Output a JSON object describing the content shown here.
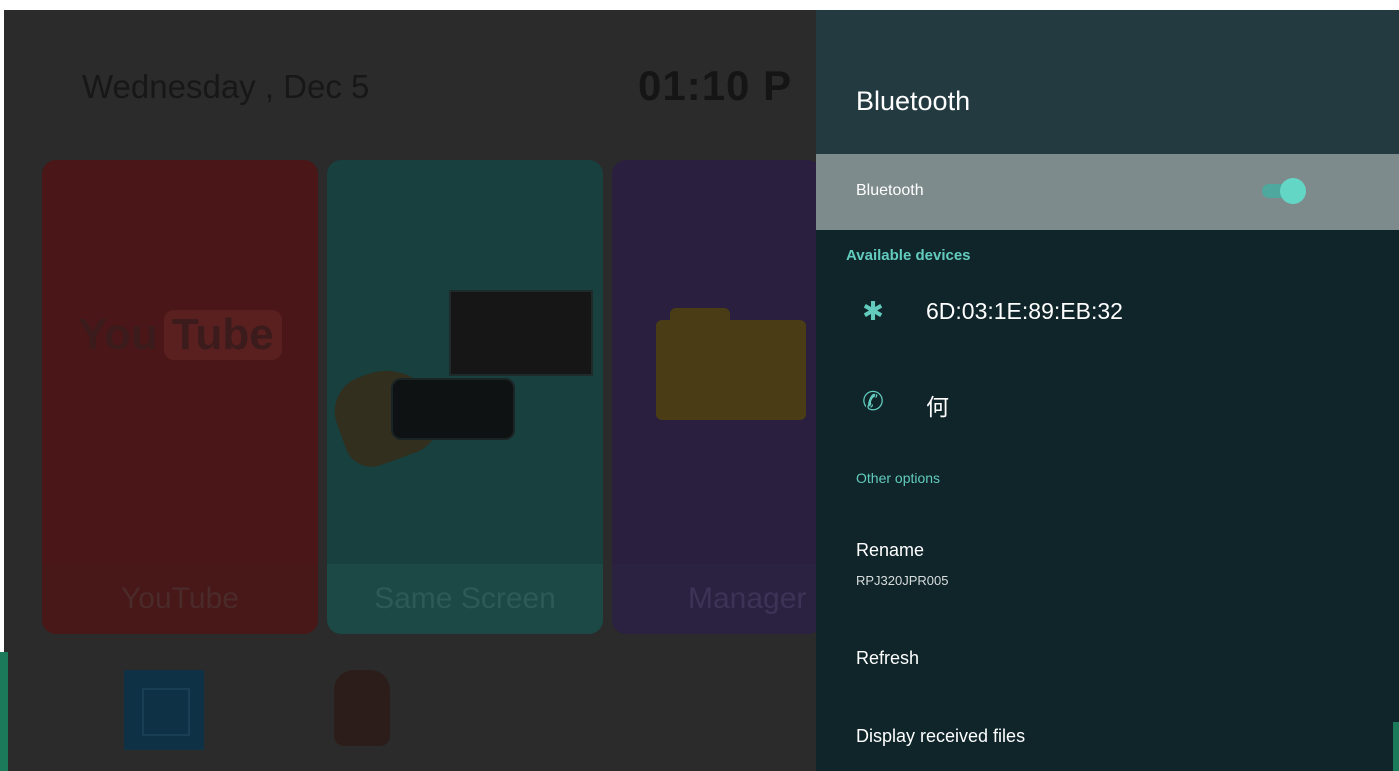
{
  "launcher": {
    "date": "Wednesday , Dec 5",
    "time": "01:10",
    "time_suffix": "P",
    "tiles": [
      {
        "label": "YouTube",
        "logo_you": "You",
        "logo_tube": "Tube"
      },
      {
        "label": "Same Screen"
      },
      {
        "label": "Manager"
      }
    ]
  },
  "panel": {
    "title": "Bluetooth",
    "toggle": {
      "label": "Bluetooth",
      "on": true
    },
    "available_header": "Available devices",
    "devices": [
      {
        "icon": "bluetooth-icon",
        "glyph": "✱",
        "name": "6D:03:1E:89:EB:32"
      },
      {
        "icon": "phone-icon",
        "glyph": "✆",
        "name": "何"
      }
    ],
    "other_header": "Other options",
    "options": {
      "rename": {
        "label": "Rename",
        "value": "RPJ320JPR005"
      },
      "refresh": {
        "label": "Refresh"
      },
      "received": {
        "label": "Display received files"
      }
    }
  },
  "colors": {
    "accent": "#62cbbd",
    "panel_bg": "#0f252a",
    "selected_row": "#7e8b8d"
  }
}
